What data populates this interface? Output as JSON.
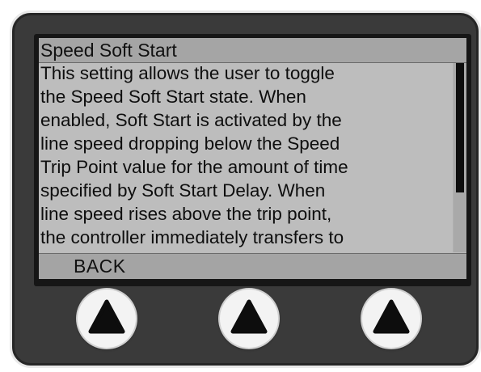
{
  "screen": {
    "title": "Speed Soft Start",
    "body_lines": [
      "This setting allows the user to toggle",
      "the Speed Soft Start state.  When",
      "enabled, Soft Start is activated by the",
      "line speed dropping below the Speed",
      "Trip Point value for the amount of time",
      "specified by Soft Start Delay.  When",
      "line speed rises above the trip point,",
      "the controller immediately transfers to"
    ],
    "back_label": "BACK"
  },
  "keys": [
    {
      "icon": "up-arrow-icon"
    },
    {
      "icon": "up-arrow-icon"
    },
    {
      "icon": "up-arrow-icon"
    }
  ],
  "colors": {
    "screen_bg": "#bdbdbd",
    "bar_bg": "#a5a5a5",
    "text": "#111111",
    "housing": "#3a3a3a",
    "key": "#f3f3f3"
  }
}
